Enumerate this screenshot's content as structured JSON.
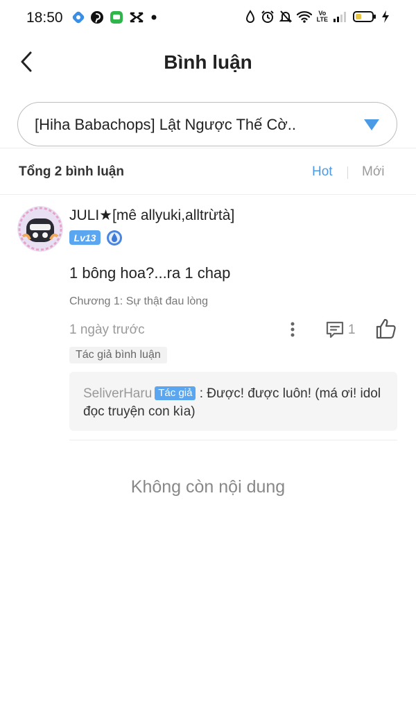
{
  "status_bar": {
    "time": "18:50",
    "volte_top": "Vo",
    "volte_bottom": "LTE"
  },
  "header": {
    "title": "Bình luận"
  },
  "chapter_selector": {
    "selected": "[Hiha Babachops] Lật Ngược Thế Cờ.."
  },
  "summary": {
    "count_label": "Tổng 2 bình luận",
    "sort_hot": "Hot",
    "sort_new": "Mới"
  },
  "comment": {
    "username": "JULI★[mê allyuki,alltrừtà]",
    "level": "Lv13",
    "text": "1 bông hoa?...ra 1 chap",
    "chapter": "Chương 1: Sự thật đau lòng",
    "time": "1 ngày trước",
    "reply_count": "1",
    "tag": "Tác giả bình luận",
    "reply": {
      "name": "SeliverHaru",
      "badge": "Tác giả",
      "text": " : Được! được luôn! (má ơi! idol đọc truyện con kìa)"
    }
  },
  "footer": {
    "end_text": "Không còn nội dung"
  },
  "colors": {
    "accent": "#4a9be6",
    "badge_blue": "#5aa6f0",
    "muted": "#9a9a9a"
  }
}
